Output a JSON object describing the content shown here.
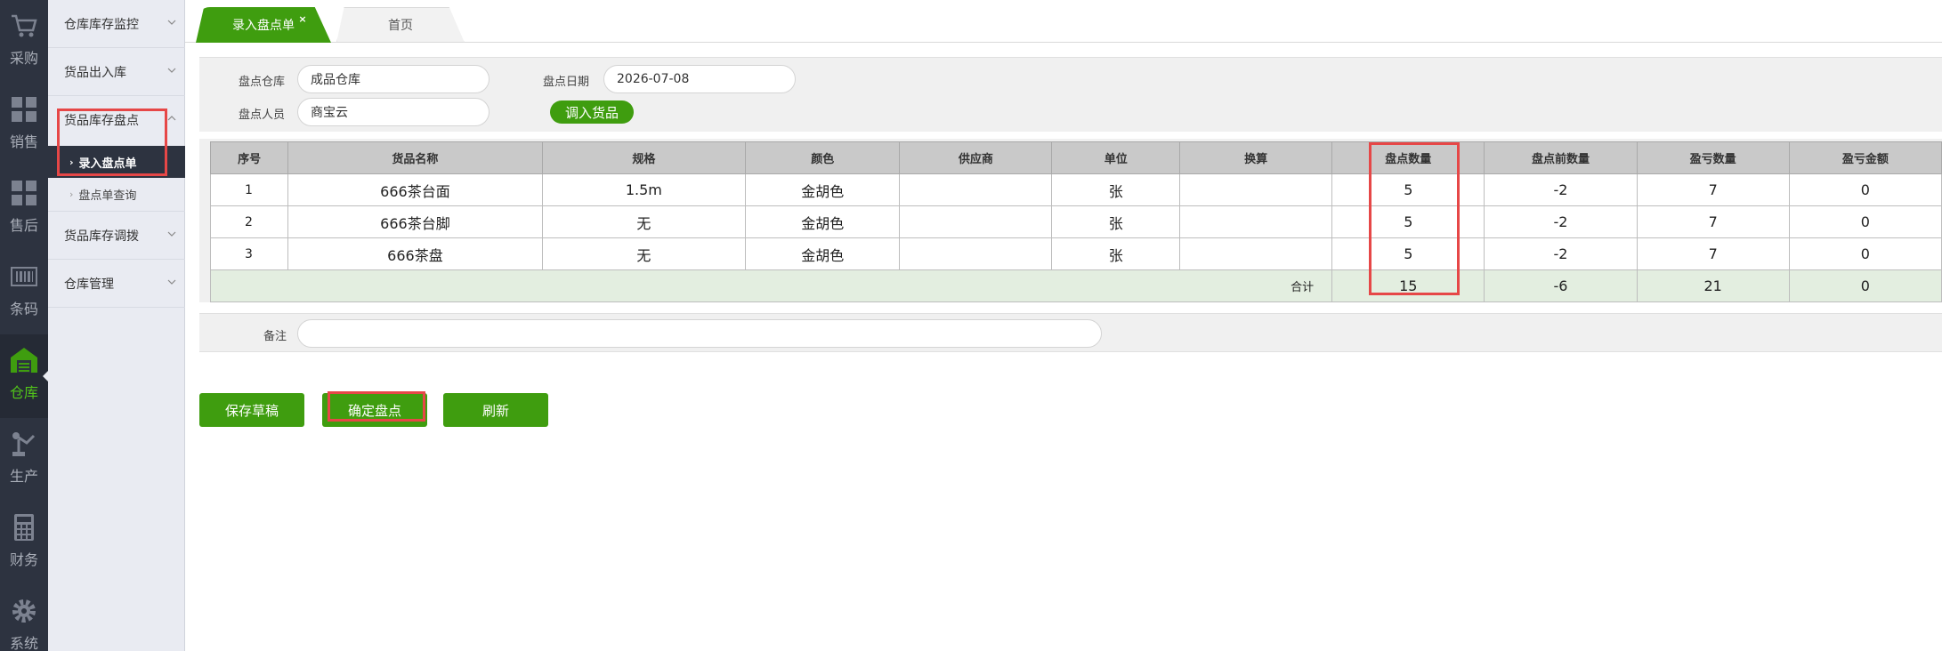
{
  "nav": {
    "items": [
      {
        "label": "采购",
        "icon": "cart-icon"
      },
      {
        "label": "销售",
        "icon": "grid-icon"
      },
      {
        "label": "售后",
        "icon": "grid-icon"
      },
      {
        "label": "条码",
        "icon": "barcode-icon"
      },
      {
        "label": "仓库",
        "icon": "warehouse-icon",
        "active": true
      },
      {
        "label": "生产",
        "icon": "robot-arm-icon"
      },
      {
        "label": "财务",
        "icon": "calculator-icon"
      },
      {
        "label": "系统",
        "icon": "gear-icon"
      }
    ]
  },
  "submenu": {
    "groups": [
      {
        "label": "仓库库存监控"
      },
      {
        "label": "货品出入库"
      },
      {
        "label": "货品库存盘点"
      },
      {
        "label": "货品库存调拨"
      },
      {
        "label": "仓库管理"
      }
    ],
    "sub_items": [
      {
        "label": "录入盘点单",
        "active": true
      },
      {
        "label": "盘点单查询"
      }
    ]
  },
  "tabs": [
    {
      "label": "录入盘点单",
      "active": true,
      "close": "×"
    },
    {
      "label": "首页"
    }
  ],
  "form": {
    "warehouse_label": "盘点仓库",
    "warehouse_value": "成品仓库",
    "date_label": "盘点日期",
    "date_value": "2026-07-08",
    "person_label": "盘点人员",
    "person_value": "商宝云",
    "import_button": "调入货品"
  },
  "table": {
    "columns": [
      "序号",
      "货品名称",
      "规格",
      "颜色",
      "供应商",
      "单位",
      "换算",
      "盘点数量",
      "盘点前数量",
      "盈亏数量",
      "盈亏金额"
    ],
    "rows": [
      [
        "1",
        "666茶台面",
        "1.5m",
        "金胡色",
        "",
        "张",
        "",
        "5",
        "-2",
        "7",
        "0"
      ],
      [
        "2",
        "666茶台脚",
        "无",
        "金胡色",
        "",
        "张",
        "",
        "5",
        "-2",
        "7",
        "0"
      ],
      [
        "3",
        "666茶盘",
        "无",
        "金胡色",
        "",
        "张",
        "",
        "5",
        "-2",
        "7",
        "0"
      ]
    ],
    "total": {
      "label": "合计",
      "count_qty": "15",
      "before_qty": "-6",
      "diff_qty": "21",
      "diff_amount": "0"
    }
  },
  "remark": {
    "label": "备注",
    "value": ""
  },
  "buttons": {
    "save_draft": "保存草稿",
    "confirm": "确定盘点",
    "refresh": "刷新"
  },
  "colors": {
    "accent_green": "#3f9d0f",
    "highlight_red": "#e64747",
    "nav_dark": "#2d3340"
  }
}
